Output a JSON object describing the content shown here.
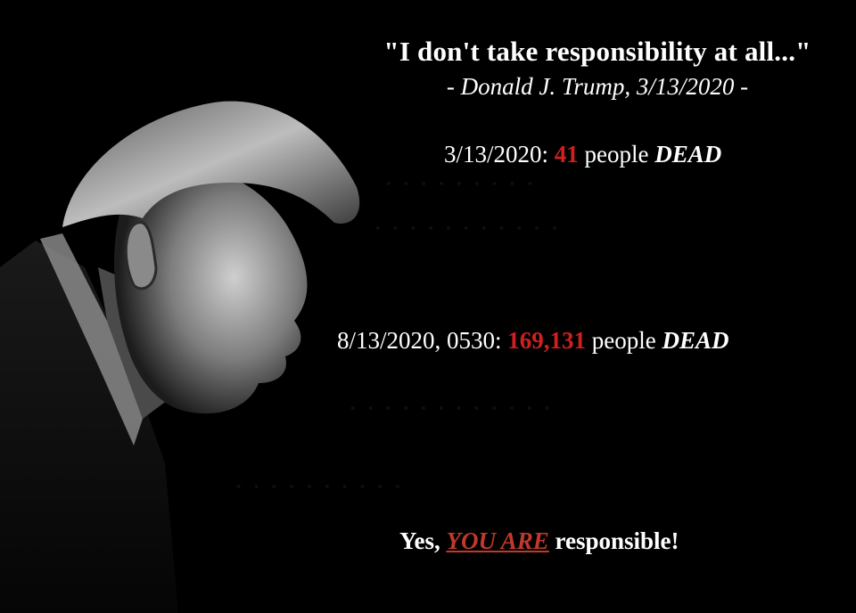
{
  "quote": {
    "text": "\"I don't take responsibility at all...\"",
    "attribution": "- Donald J. Trump, 3/13/2020 -"
  },
  "stats": [
    {
      "prefix": "3/13/2020: ",
      "number": "41",
      "middle": " people ",
      "suffix": "DEAD"
    },
    {
      "prefix": "8/13/2020, 0530: ",
      "number": "169,131",
      "middle": " people ",
      "suffix": "DEAD"
    }
  ],
  "closing": {
    "before": "Yes, ",
    "emphasis": "YOU ARE",
    "after": " responsible!"
  },
  "colors": {
    "background": "#000000",
    "text": "#ffffff",
    "number": "#d11f1f",
    "emphasis": "#c0392b"
  }
}
